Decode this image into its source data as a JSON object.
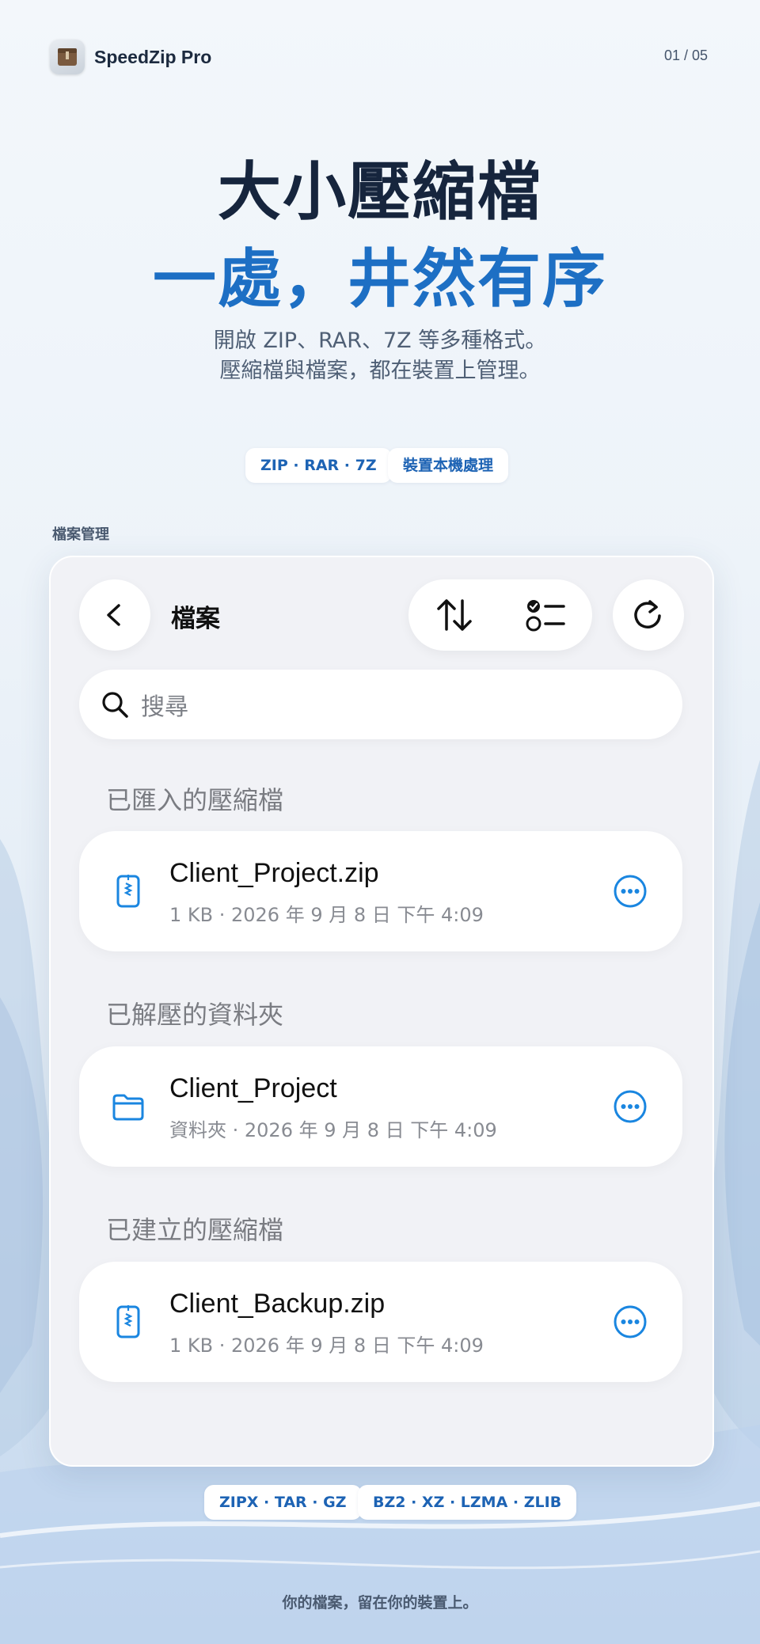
{
  "brand": {
    "name": "SpeedZip Pro",
    "icon": "archive-box-icon"
  },
  "page_indicator": "01 / 05",
  "headline": {
    "line1": "大小壓縮檔",
    "line2": "一處，井然有序"
  },
  "subtitle": {
    "line1": "開啟 ZIP、RAR、7Z 等多種格式。",
    "line2": "壓縮檔與檔案，都在裝置上管理。"
  },
  "top_pills": [
    "ZIP · RAR · 7Z",
    "裝置本機處理"
  ],
  "section_tag": "檔案管理",
  "app": {
    "nav_title": "檔案",
    "search_placeholder": "搜尋",
    "groups": [
      {
        "header": "已匯入的壓縮檔",
        "item": {
          "name": "Client_Project.zip",
          "meta": "1 KB · 2026 年 9 月 8 日 下午 4:09",
          "icon": "zip-file-icon"
        }
      },
      {
        "header": "已解壓的資料夾",
        "item": {
          "name": "Client_Project",
          "meta": "資料夾 · 2026 年 9 月 8 日 下午 4:09",
          "icon": "folder-icon"
        }
      },
      {
        "header": "已建立的壓縮檔",
        "item": {
          "name": "Client_Backup.zip",
          "meta": "1 KB · 2026 年 9 月 8 日 下午 4:09",
          "icon": "zip-file-icon"
        }
      }
    ]
  },
  "bottom_pills": [
    "ZIPX · TAR · GZ",
    "BZ2 · XZ · LZMA · ZLIB"
  ],
  "footer": "你的檔案，留在你的裝置上。",
  "colors": {
    "accent": "#1d6fc4",
    "icon_blue": "#1a86e0",
    "headline_dark": "#16253d"
  }
}
